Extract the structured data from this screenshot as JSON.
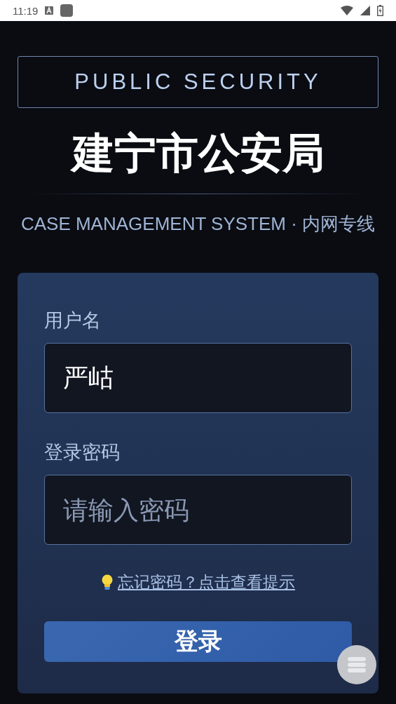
{
  "status_bar": {
    "time": "11:19"
  },
  "header": {
    "org_en": "PUBLIC SECURITY",
    "title": "建宁市公安局",
    "subtitle": "CASE MANAGEMENT SYSTEM · 内网专线"
  },
  "form": {
    "fields": [
      {
        "label": "用户名",
        "value": "严岵"
      },
      {
        "label": "登录密码",
        "placeholder": "请输入密码"
      }
    ],
    "hint_link": "忘记密码？点击查看提示",
    "login_button": "登录"
  }
}
